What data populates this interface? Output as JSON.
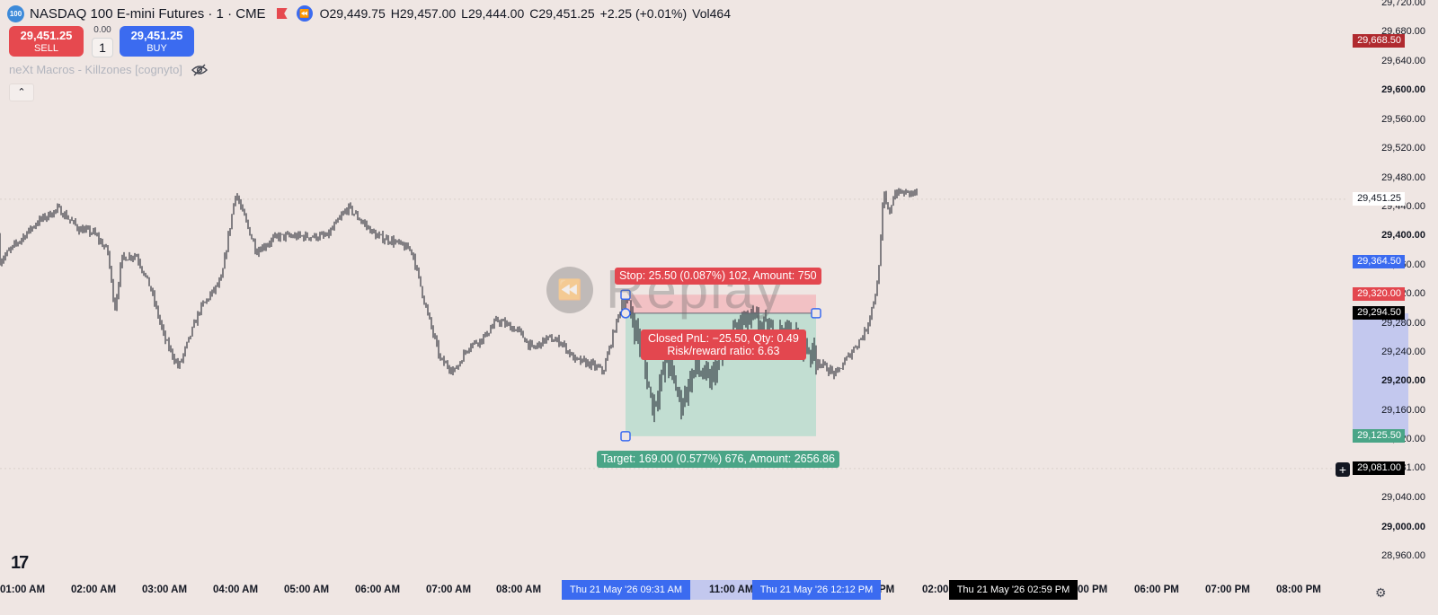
{
  "header": {
    "badge": "100",
    "symbol": "NASDAQ 100 E-mini Futures · 1 · CME",
    "open": "O29,449.75",
    "high": "H29,457.00",
    "low": "L29,444.00",
    "close": "C29,451.25",
    "change": "+2.25 (+0.01%)",
    "volume": "Vol464"
  },
  "trade": {
    "sell_price": "29,451.25",
    "sell_label": "SELL",
    "spread": "0.00",
    "quantity": "1",
    "buy_price": "29,451.25",
    "buy_label": "BUY"
  },
  "indicator": {
    "name": "neXt Macros - Killzones [cognyto]"
  },
  "position_tool": {
    "stop_label": "Stop: 25.50 (0.087%) 102, Amount: 750",
    "pnl_line1": "Closed PnL: −25.50, Qty: 0.49",
    "pnl_line2": "Risk/reward ratio: 6.63",
    "target_label": "Target: 169.00 (0.577%) 676, Amount: 2656.86",
    "entry_price": 29294.5,
    "stop_price": 29320.0,
    "target_price": 29125.5
  },
  "watermark": {
    "text": "Replay"
  },
  "y_axis": {
    "ticks": [
      {
        "text": "29,720.00",
        "bold": false
      },
      {
        "text": "29,680.00",
        "bold": false
      },
      {
        "text": "29,640.00",
        "bold": false
      },
      {
        "text": "29,600.00",
        "bold": true
      },
      {
        "text": "29,560.00",
        "bold": false
      },
      {
        "text": "29,520.00",
        "bold": false
      },
      {
        "text": "29,480.00",
        "bold": false
      },
      {
        "text": "29,440.00",
        "bold": false
      },
      {
        "text": "29,400.00",
        "bold": true
      },
      {
        "text": "29,360.00",
        "bold": false
      },
      {
        "text": "29,320.00",
        "bold": false
      },
      {
        "text": "29,280.00",
        "bold": false
      },
      {
        "text": "29,240.00",
        "bold": false
      },
      {
        "text": "29,200.00",
        "bold": true
      },
      {
        "text": "29,160.00",
        "bold": false
      },
      {
        "text": "29,120.00",
        "bold": false
      },
      {
        "text": "29,081.00",
        "bold": false
      },
      {
        "text": "29,040.00",
        "bold": false
      },
      {
        "text": "29,000.00",
        "bold": true
      },
      {
        "text": "28,960.00",
        "bold": false
      }
    ],
    "tags": [
      {
        "text": "29,668.50",
        "bg": "#b02a2f",
        "fg": "#ffffff",
        "price": 29668.5
      },
      {
        "text": "29,451.25",
        "bg": "#ffffff",
        "fg": "#131722",
        "price": 29451.25
      },
      {
        "text": "29,364.50",
        "bg": "#3b6bf0",
        "fg": "#ffffff",
        "price": 29364.5
      },
      {
        "text": "29,320.00",
        "bg": "#e3474f",
        "fg": "#ffffff",
        "price": 29320.0
      },
      {
        "text": "29,294.50",
        "bg": "#000000",
        "fg": "#ffffff",
        "price": 29294.5
      },
      {
        "text": "29,125.50",
        "bg": "#4aa587",
        "fg": "#ffffff",
        "price": 29125.5
      },
      {
        "text": "29,081.00",
        "bg": "#000000",
        "fg": "#ffffff",
        "price": 29081.0
      }
    ]
  },
  "x_axis": {
    "labels": [
      "01:00 AM",
      "02:00 AM",
      "03:00 AM",
      "04:00 AM",
      "05:00 AM",
      "06:00 AM",
      "07:00 AM",
      "08:00 AM",
      "11:00 AM",
      "PM",
      "02:00",
      "00 PM",
      "06:00 PM",
      "07:00 PM",
      "08:00 PM"
    ],
    "highlights": [
      {
        "text": "Thu 21 May '26   09:31 AM",
        "bg": "#3b6bf0"
      },
      {
        "text": "Thu 21 May '26   12:12 PM",
        "bg": "#3b6bf0"
      },
      {
        "text": "Thu 21 May '26   02:59 PM",
        "bg": "#000000"
      }
    ]
  },
  "chart_data": {
    "type": "candlestick",
    "ylim": [
      28945,
      29728
    ],
    "price_path": [
      [
        1.0,
        29400
      ],
      [
        1.2,
        29420
      ],
      [
        1.5,
        29438
      ],
      [
        1.8,
        29410
      ],
      [
        2.0,
        29405
      ],
      [
        2.2,
        29380
      ],
      [
        2.3,
        29300
      ],
      [
        2.4,
        29370
      ],
      [
        2.6,
        29375
      ],
      [
        2.8,
        29330
      ],
      [
        3.0,
        29260
      ],
      [
        3.2,
        29220
      ],
      [
        3.5,
        29300
      ],
      [
        3.8,
        29340
      ],
      [
        4.0,
        29460
      ],
      [
        4.3,
        29380
      ],
      [
        4.6,
        29400
      ],
      [
        5.0,
        29400
      ],
      [
        5.3,
        29400
      ],
      [
        5.6,
        29440
      ],
      [
        6.0,
        29400
      ],
      [
        6.2,
        29395
      ],
      [
        6.5,
        29380
      ],
      [
        6.7,
        29300
      ],
      [
        6.9,
        29230
      ],
      [
        7.1,
        29215
      ],
      [
        7.3,
        29250
      ],
      [
        7.5,
        29260
      ],
      [
        7.7,
        29285
      ],
      [
        8.0,
        29270
      ],
      [
        8.2,
        29245
      ],
      [
        8.4,
        29260
      ],
      [
        8.6,
        29255
      ],
      [
        8.8,
        29230
      ],
      [
        9.0,
        29225
      ],
      [
        9.2,
        29215
      ],
      [
        9.35,
        29270
      ],
      [
        9.5,
        29320
      ],
      [
        9.7,
        29260
      ],
      [
        9.9,
        29165
      ],
      [
        10.1,
        29230
      ],
      [
        10.3,
        29170
      ],
      [
        10.5,
        29220
      ],
      [
        10.7,
        29200
      ],
      [
        10.9,
        29240
      ],
      [
        11.1,
        29280
      ],
      [
        11.3,
        29285
      ],
      [
        11.5,
        29270
      ],
      [
        11.8,
        29265
      ],
      [
        12.0,
        29250
      ],
      [
        12.2,
        29225
      ],
      [
        12.4,
        29210
      ],
      [
        12.6,
        29240
      ],
      [
        12.8,
        29270
      ],
      [
        12.95,
        29330
      ],
      [
        13.05,
        29460
      ],
      [
        13.15,
        29430
      ],
      [
        13.25,
        29460
      ]
    ],
    "x_hours": [
      1,
      2,
      3,
      4,
      5,
      6,
      7,
      8,
      11,
      13,
      14,
      16,
      17,
      18,
      19,
      20
    ]
  }
}
